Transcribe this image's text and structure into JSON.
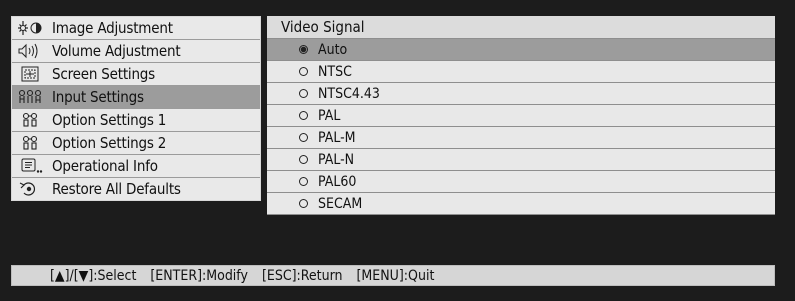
{
  "menu": {
    "items": [
      {
        "label": "Image Adjustment",
        "icon": "image-adjustment-icon",
        "active": false
      },
      {
        "label": "Volume Adjustment",
        "icon": "speaker-icon",
        "active": false
      },
      {
        "label": "Screen Settings",
        "icon": "screen-icon",
        "active": false
      },
      {
        "label": "Input Settings",
        "icon": "input-icon",
        "active": true
      },
      {
        "label": "Option Settings 1",
        "icon": "option-settings-icon",
        "active": false
      },
      {
        "label": "Option Settings 2",
        "icon": "option-settings-icon",
        "active": false
      },
      {
        "label": "Operational Info",
        "icon": "info-icon",
        "active": false
      },
      {
        "label": "Restore All Defaults",
        "icon": "restore-icon",
        "active": false
      }
    ]
  },
  "panel": {
    "header": "Video Signal",
    "options": [
      {
        "label": "Auto",
        "selected": true
      },
      {
        "label": "NTSC",
        "selected": false
      },
      {
        "label": "NTSC4.43",
        "selected": false
      },
      {
        "label": "PAL",
        "selected": false
      },
      {
        "label": "PAL-M",
        "selected": false
      },
      {
        "label": "PAL-N",
        "selected": false
      },
      {
        "label": "PAL60",
        "selected": false
      },
      {
        "label": "SECAM",
        "selected": false
      }
    ]
  },
  "status": {
    "select": "[▲]/[▼]:Select",
    "modify": "[ENTER]:Modify",
    "return": "[ESC]:Return",
    "quit": "[MENU]:Quit"
  },
  "colors": {
    "background": "#1c1c1c",
    "item": "#e9e9e9",
    "highlight": "#9c9c9c"
  }
}
